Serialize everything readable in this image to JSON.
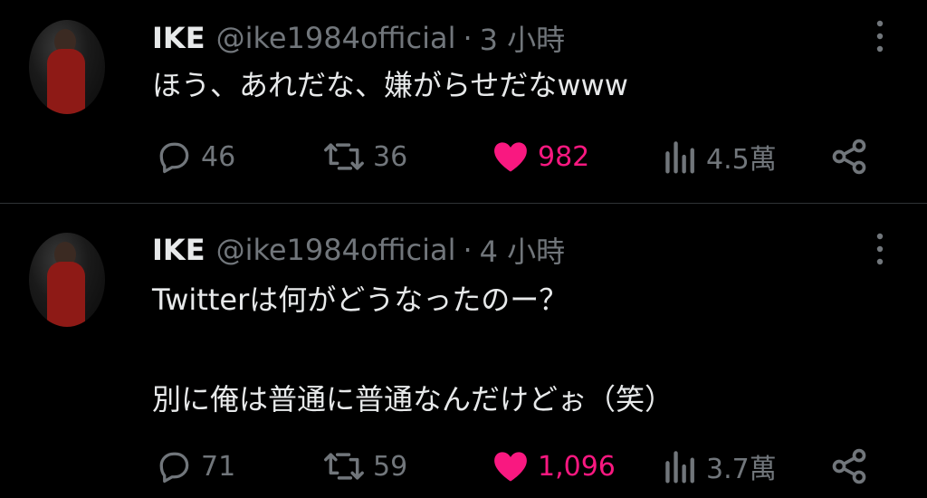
{
  "tweets": [
    {
      "author": {
        "name": "IKE",
        "handle": "@ike1984official"
      },
      "time": "3 小時",
      "text_lines": [
        "ほう、あれだな、嫌がらせだなwww"
      ],
      "stats": {
        "replies": "46",
        "retweets": "36",
        "likes": "982",
        "views": "4.5萬"
      },
      "liked": true
    },
    {
      "author": {
        "name": "IKE",
        "handle": "@ike1984official"
      },
      "time": "4 小時",
      "text_lines": [
        "Twitterは何がどうなったのー？",
        "",
        "別に俺は普通に普通なんだけどぉ（笑）"
      ],
      "stats": {
        "replies": "71",
        "retweets": "59",
        "likes": "1,096",
        "views": "3.7萬"
      },
      "liked": true
    }
  ],
  "separator": "·",
  "icons": {
    "avatar": "avatar-photo",
    "more": "more-vertical-icon",
    "reply": "reply-bubble-icon",
    "retweet": "retweet-icon",
    "like": "heart-icon",
    "views": "views-bar-chart-icon",
    "share": "share-icon"
  },
  "colors": {
    "background": "#000000",
    "text": "#e7e9ea",
    "secondary": "#71767b",
    "like": "#f91880",
    "divider": "#2f3336"
  }
}
